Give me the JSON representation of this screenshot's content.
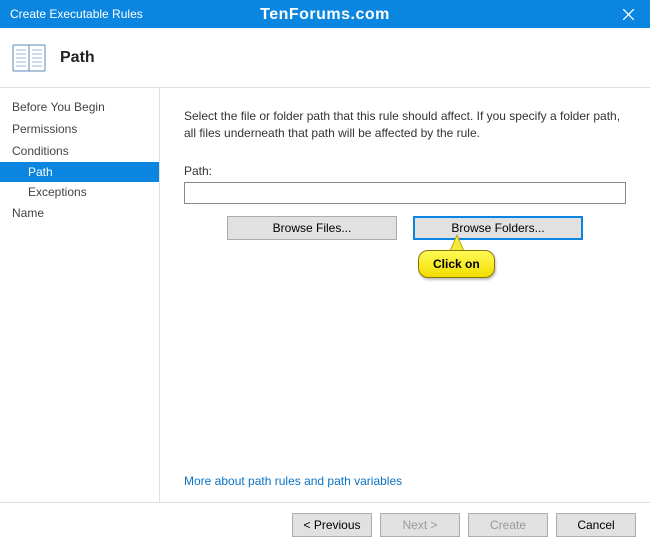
{
  "titlebar": {
    "title": "Create Executable Rules"
  },
  "watermark": "TenForums.com",
  "header": {
    "title": "Path"
  },
  "nav": {
    "items": [
      {
        "label": "Before You Begin"
      },
      {
        "label": "Permissions"
      },
      {
        "label": "Conditions",
        "children": [
          {
            "label": "Path",
            "selected": true
          },
          {
            "label": "Exceptions"
          }
        ]
      },
      {
        "label": "Name"
      }
    ],
    "before": "Before You Begin",
    "perm": "Permissions",
    "cond": "Conditions",
    "path": "Path",
    "exc": "Exceptions",
    "name": "Name"
  },
  "content": {
    "instructions": "Select the file or folder path that this rule should affect. If you specify a folder path, all files underneath that path will be affected by the rule.",
    "path_label": "Path:",
    "path_value": "",
    "browse_files": "Browse Files...",
    "browse_folders": "Browse Folders...",
    "more_link": "More about path rules and path variables"
  },
  "callout": {
    "text": "Click on"
  },
  "footer": {
    "previous": "< Previous",
    "next": "Next >",
    "create": "Create",
    "cancel": "Cancel"
  }
}
